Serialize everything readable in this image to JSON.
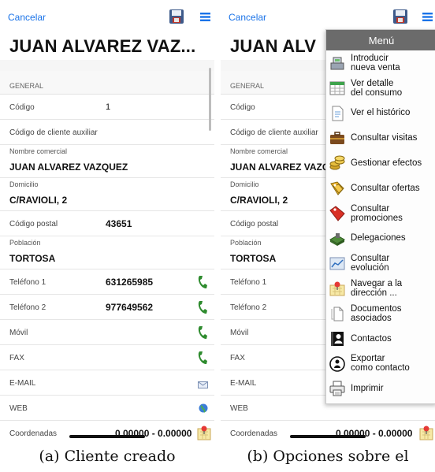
{
  "screen_a": {
    "cancel_label": "Cancelar",
    "title": "JUAN ALVAREZ VAZ...",
    "section_header": "GENERAL",
    "fields": {
      "codigo": {
        "label": "Código",
        "value": "1"
      },
      "codigo_auxiliar": {
        "label": "Código de cliente auxiliar",
        "value": ""
      },
      "nombre_comercial": {
        "label": "Nombre comercial",
        "value": "JUAN ALVAREZ VAZQUEZ"
      },
      "domicilio": {
        "label": "Domicilio",
        "value": "C/RAVIOLI, 2"
      },
      "codigo_postal": {
        "label": "Código postal",
        "value": "43651"
      },
      "poblacion": {
        "label": "Población",
        "value": "TORTOSA"
      },
      "telefono1": {
        "label": "Teléfono 1",
        "value": "631265985"
      },
      "telefono2": {
        "label": "Teléfono 2",
        "value": "977649562"
      },
      "movil": {
        "label": "Móvil",
        "value": ""
      },
      "fax": {
        "label": "FAX",
        "value": ""
      },
      "email": {
        "label": "E-MAIL",
        "value": ""
      },
      "web": {
        "label": "WEB",
        "value": ""
      },
      "coordenadas": {
        "label": "Coordenadas",
        "value": "0.00000 - 0.00000"
      }
    }
  },
  "screen_b": {
    "cancel_label": "Cancelar",
    "title": "JUAN ALV",
    "section_header": "GENERAL",
    "fields": {
      "codigo": {
        "label": "Código"
      },
      "codigo_auxiliar": {
        "label": "Código de cliente auxiliar"
      },
      "nombre_comercial": {
        "label": "Nombre comercial",
        "value": "JUAN ALVAREZ VAZQ"
      },
      "domicilio": {
        "label": "Domicilio",
        "value": "C/RAVIOLI, 2"
      },
      "codigo_postal": {
        "label": "Código postal"
      },
      "poblacion": {
        "label": "Población",
        "value": "TORTOSA"
      },
      "telefono1": {
        "label": "Teléfono 1"
      },
      "telefono2": {
        "label": "Teléfono 2"
      },
      "movil": {
        "label": "Móvil"
      },
      "fax": {
        "label": "FAX"
      },
      "email": {
        "label": "E-MAIL"
      },
      "web": {
        "label": "WEB"
      },
      "coordenadas": {
        "label": "Coordenadas",
        "value": "0.00000 - 0.00000"
      }
    },
    "menu": {
      "title": "Menú",
      "items": [
        {
          "label": "Introducir\nnueva venta",
          "icon": "cash-register-icon"
        },
        {
          "label": "Ver detalle\ndel consumo",
          "icon": "spreadsheet-icon"
        },
        {
          "label": "Ver el histórico",
          "icon": "document-icon"
        },
        {
          "label": "Consultar visitas",
          "icon": "briefcase-icon"
        },
        {
          "label": "Gestionar efectos",
          "icon": "coins-icon"
        },
        {
          "label": "Consultar ofertas",
          "icon": "price-tags-icon"
        },
        {
          "label": "Consultar\npromociones",
          "icon": "promo-tag-icon"
        },
        {
          "label": "Delegaciones",
          "icon": "delegations-icon"
        },
        {
          "label": "Consultar\nevolución",
          "icon": "line-chart-icon"
        },
        {
          "label": "Navegar a la\ndirección ...",
          "icon": "map-pin-icon"
        },
        {
          "label": "Documentos\nasociados",
          "icon": "documents-icon"
        },
        {
          "label": "Contactos",
          "icon": "contacts-book-icon"
        },
        {
          "label": "Exportar\ncomo contacto",
          "icon": "export-contact-icon"
        },
        {
          "label": "Imprimir",
          "icon": "printer-icon"
        }
      ]
    }
  },
  "captions": {
    "a": "(a) Cliente creado",
    "b": "(b) Opciones sobre el"
  },
  "colors": {
    "link": "#1a73e8",
    "menu_header_bg": "#6b6b6b",
    "phone_icon": "#2e8b2e"
  }
}
